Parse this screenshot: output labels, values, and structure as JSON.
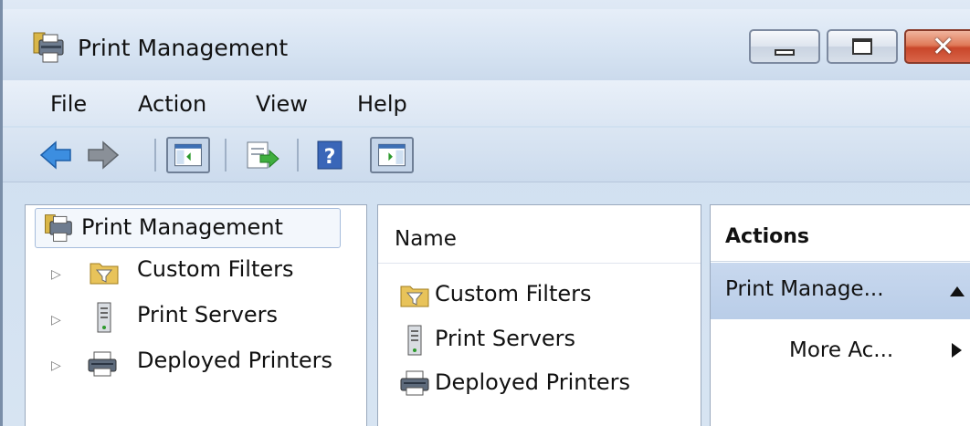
{
  "window": {
    "title": "Print Management",
    "icon": "print-management-icon"
  },
  "menu": {
    "file": "File",
    "action": "Action",
    "view": "View",
    "help": "Help"
  },
  "toolbar": {
    "buttons": [
      "back-arrow-icon",
      "forward-arrow-icon",
      "show-hide-console-tree-icon",
      "export-list-icon",
      "help-icon",
      "show-hide-action-pane-icon"
    ]
  },
  "tree": {
    "root": "Print Management",
    "items": [
      {
        "label": "Custom Filters",
        "icon": "filter-folder-icon"
      },
      {
        "label": "Print Servers",
        "icon": "server-icon"
      },
      {
        "label": "Deployed Printers",
        "icon": "printer-icon"
      }
    ]
  },
  "list": {
    "column_name": "Name",
    "items": [
      {
        "label": "Custom Filters",
        "icon": "filter-folder-icon"
      },
      {
        "label": "Print Servers",
        "icon": "server-icon"
      },
      {
        "label": "Deployed Printers",
        "icon": "printer-icon"
      }
    ]
  },
  "actions": {
    "title": "Actions",
    "group_label": "Print Manage...",
    "more_actions": "More Ac..."
  },
  "colors": {
    "accent_selection": "#b9cde8",
    "close_button": "#c9462a"
  }
}
